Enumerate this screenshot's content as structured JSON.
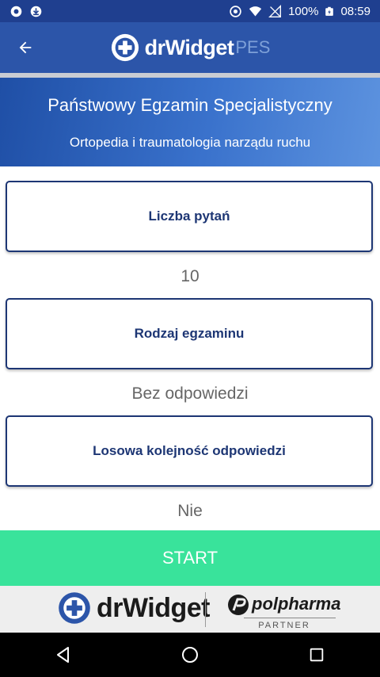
{
  "status_bar": {
    "battery": "100%",
    "time": "08:59"
  },
  "app_bar": {
    "logo_main": "drWidget",
    "logo_sub": "PES"
  },
  "header": {
    "title": "Państwowy Egzamin Specjalistyczny",
    "subtitle": "Ortopedia i traumatologia narządu ruchu"
  },
  "options": [
    {
      "label": "Liczba pytań",
      "value": "10"
    },
    {
      "label": "Rodzaj egzaminu",
      "value": "Bez odpowiedzi"
    },
    {
      "label": "Losowa kolejność odpowiedzi",
      "value": "Nie"
    }
  ],
  "start_button": {
    "label": "START"
  },
  "footer": {
    "brand": "drWidget",
    "partner_name": "polpharma",
    "partner_label": "PARTNER"
  },
  "colors": {
    "app_bar": "#2c55a9",
    "status_bar": "#1f3f8f",
    "accent_navy": "#1d3674",
    "start_green": "#39e39b"
  }
}
